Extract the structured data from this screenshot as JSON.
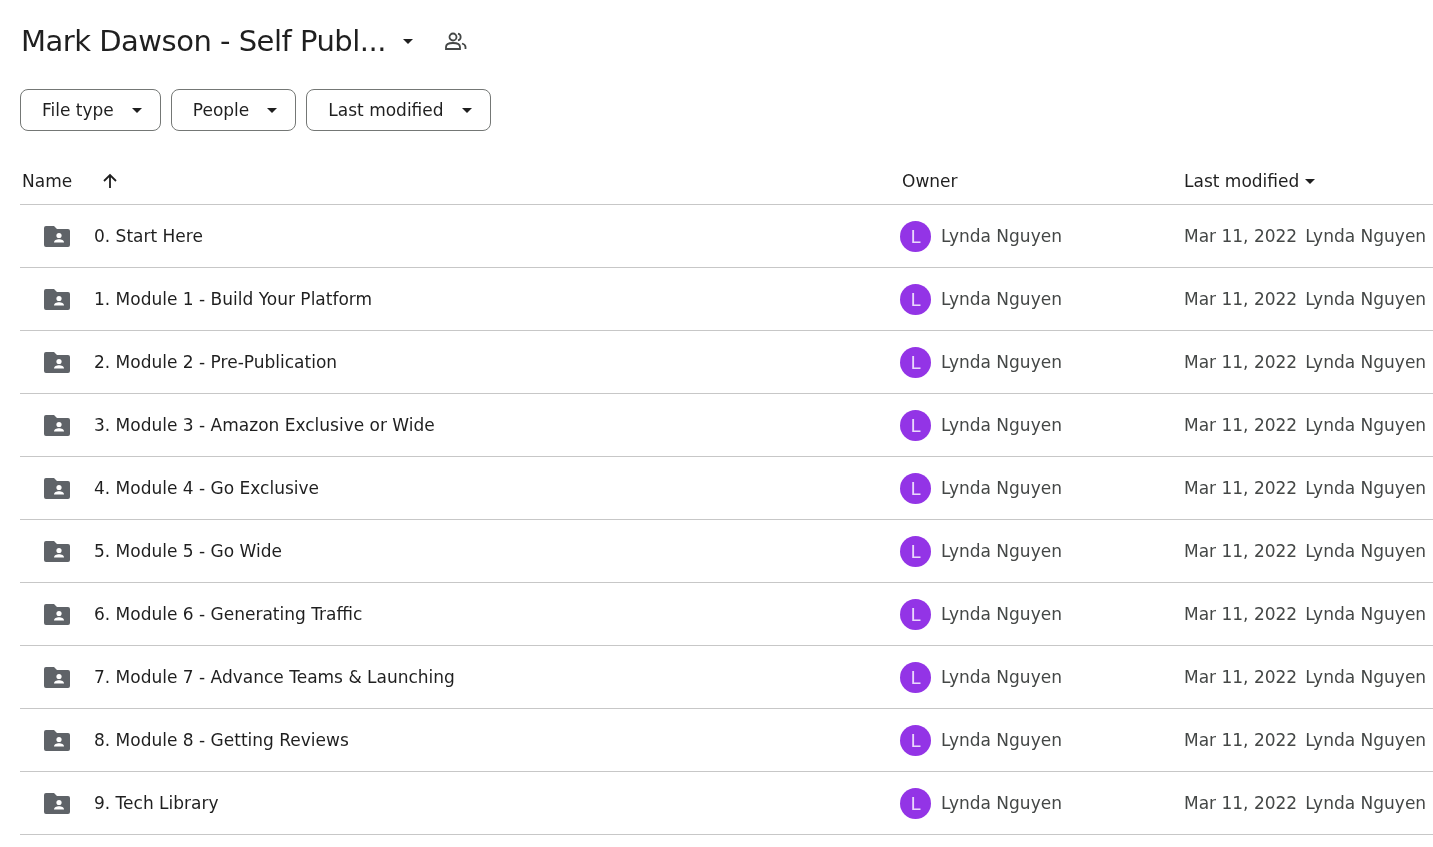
{
  "header": {
    "title": "Mark Dawson - Self Publ..."
  },
  "filters": [
    {
      "label": "File type"
    },
    {
      "label": "People"
    },
    {
      "label": "Last modified"
    }
  ],
  "table": {
    "columns": [
      {
        "label": "Name",
        "sorted_ascending": true,
        "sorted_descending": false
      },
      {
        "label": "Owner",
        "sorted_ascending": false,
        "sorted_descending": false
      },
      {
        "label": "Last modified",
        "sorted_ascending": false,
        "sorted_descending": true
      }
    ],
    "rows": [
      {
        "name": "0. Start Here",
        "avatar": "L",
        "owner": "Lynda Nguyen",
        "date": "Mar 11, 2022",
        "modified_by": "Lynda Nguyen"
      },
      {
        "name": "1. Module 1 - Build Your Platform",
        "avatar": "L",
        "owner": "Lynda Nguyen",
        "date": "Mar 11, 2022",
        "modified_by": "Lynda Nguyen"
      },
      {
        "name": "2. Module 2 - Pre-Publication",
        "avatar": "L",
        "owner": "Lynda Nguyen",
        "date": "Mar 11, 2022",
        "modified_by": "Lynda Nguyen"
      },
      {
        "name": "3. Module 3 - Amazon Exclusive or Wide",
        "avatar": "L",
        "owner": "Lynda Nguyen",
        "date": "Mar 11, 2022",
        "modified_by": "Lynda Nguyen"
      },
      {
        "name": "4. Module 4 - Go Exclusive",
        "avatar": "L",
        "owner": "Lynda Nguyen",
        "date": "Mar 11, 2022",
        "modified_by": "Lynda Nguyen"
      },
      {
        "name": "5. Module 5 - Go Wide",
        "avatar": "L",
        "owner": "Lynda Nguyen",
        "date": "Mar 11, 2022",
        "modified_by": "Lynda Nguyen"
      },
      {
        "name": "6. Module 6 - Generating Traffic",
        "avatar": "L",
        "owner": "Lynda Nguyen",
        "date": "Mar 11, 2022",
        "modified_by": "Lynda Nguyen"
      },
      {
        "name": "7. Module 7 - Advance Teams & Launching",
        "avatar": "L",
        "owner": "Lynda Nguyen",
        "date": "Mar 11, 2022",
        "modified_by": "Lynda Nguyen"
      },
      {
        "name": "8. Module 8 - Getting Reviews",
        "avatar": "L",
        "owner": "Lynda Nguyen",
        "date": "Mar 11, 2022",
        "modified_by": "Lynda Nguyen"
      },
      {
        "name": "9. Tech Library",
        "avatar": "L",
        "owner": "Lynda Nguyen",
        "date": "Mar 11, 2022",
        "modified_by": "Lynda Nguyen"
      }
    ]
  }
}
